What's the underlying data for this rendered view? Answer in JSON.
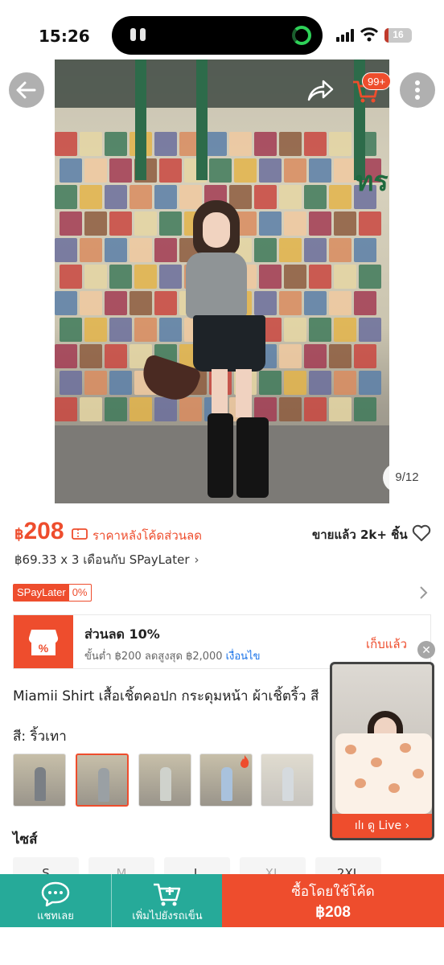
{
  "status_bar": {
    "time": "15:26",
    "battery": "16",
    "battery_level": 0.16
  },
  "gallery": {
    "counter": "9/12",
    "cart_badge": "99+",
    "sign_text": "ทรงวาด"
  },
  "price": {
    "currency": "฿",
    "value": "208",
    "after_code_label": "ราคาหลังโค้ดส่วนลด",
    "sold": "ขายแล้ว 2k+ ชิ้น"
  },
  "spaylater": {
    "installment": "฿69.33 x 3 เดือนกับ SPayLater",
    "badge_name": "SPayLater",
    "badge_rate": "0%"
  },
  "voucher": {
    "title": "ส่วนลด 10%",
    "condition": "ขั้นต่ำ ฿200 ลดสูงสุด ฿2,000",
    "condition_link": "เงื่อนไข",
    "status": "เก็บแล้ว"
  },
  "product": {
    "name": "Miamii Shirt เสื้อเชิ้ตคอปก กระดุมหน้า ผ้าเชิ้ตริ้ว สี",
    "color_label": "สี: ริ้วเทา",
    "size_label": "ไซส์",
    "sizes": [
      {
        "label": "S",
        "available": true
      },
      {
        "label": "M",
        "available": false
      },
      {
        "label": "L",
        "available": true
      },
      {
        "label": "XL",
        "available": false
      },
      {
        "label": "2XL",
        "available": true
      }
    ]
  },
  "live": {
    "label": "ดู Live"
  },
  "bottom_bar": {
    "chat_label": "แชทเลย",
    "add_cart_label": "เพิ่มไปยังรถเข็น",
    "buy_label": "ซื้อโดยใช้โค้ด",
    "buy_price": "฿208"
  },
  "colors": {
    "accent": "#ee4d2d",
    "teal": "#26aa99",
    "link": "#1a73e8"
  }
}
